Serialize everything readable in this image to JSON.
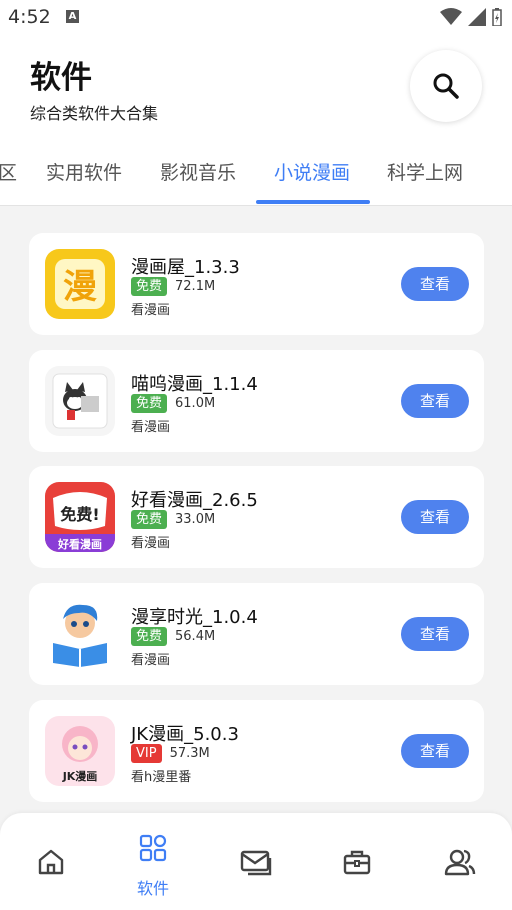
{
  "status_bar": {
    "time": "4:52",
    "notification_letter": "A"
  },
  "header": {
    "title": "软件",
    "subtitle": "综合类软件大合集",
    "search_icon": "search-icon"
  },
  "tabs": [
    {
      "label": "区",
      "active": false
    },
    {
      "label": "实用软件",
      "active": false
    },
    {
      "label": "影视音乐",
      "active": false
    },
    {
      "label": "小说漫画",
      "active": true
    },
    {
      "label": "科学上网",
      "active": false
    }
  ],
  "apps": [
    {
      "name": "漫画屋_1.3.3",
      "badge": "免费",
      "badge_color": "#4caf50",
      "size": "72.1M",
      "category": "看漫画",
      "button": "查看",
      "icon_text": "漫",
      "icon_bg": "#f7c81b"
    },
    {
      "name": "喵呜漫画_1.1.4",
      "badge": "免费",
      "badge_color": "#4caf50",
      "size": "61.0M",
      "category": "看漫画",
      "button": "查看",
      "icon_text": "",
      "icon_bg": "#f5f5f5"
    },
    {
      "name": "好看漫画_2.6.5",
      "badge": "免费",
      "badge_color": "#4caf50",
      "size": "33.0M",
      "category": "看漫画",
      "button": "查看",
      "icon_text": "免费!",
      "icon_sub": "好看漫画",
      "icon_bg": "#e8403a"
    },
    {
      "name": "漫享时光_1.0.4",
      "badge": "免费",
      "badge_color": "#4caf50",
      "size": "56.4M",
      "category": "看漫画",
      "button": "查看",
      "icon_text": "",
      "icon_bg": "#ffffff"
    },
    {
      "name": "JK漫画_5.0.3",
      "badge": "VIP",
      "badge_color": "#e53935",
      "size": "57.3M",
      "category": "看h漫里番",
      "button": "查看",
      "icon_text": "JK漫画",
      "icon_bg": "#fde2ea"
    }
  ],
  "bottom_nav": [
    {
      "icon": "home-icon",
      "label": "",
      "active": false
    },
    {
      "icon": "grid-icon",
      "label": "软件",
      "active": true
    },
    {
      "icon": "mail-icon",
      "label": "",
      "active": false
    },
    {
      "icon": "toolbox-icon",
      "label": "",
      "active": false
    },
    {
      "icon": "users-icon",
      "label": "",
      "active": false
    }
  ],
  "colors": {
    "accent": "#3f7ef5",
    "button": "#4f82ee",
    "free_badge": "#4caf50",
    "vip_badge": "#e53935"
  }
}
